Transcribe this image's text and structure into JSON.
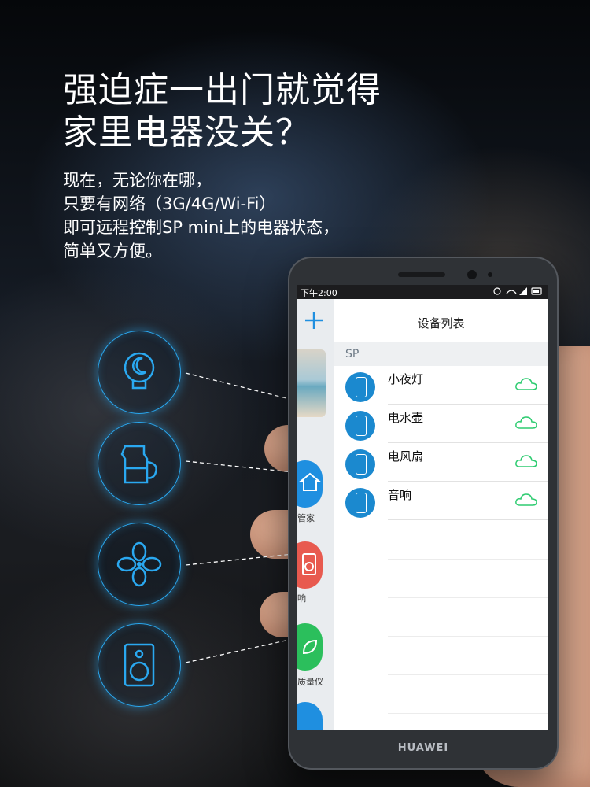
{
  "headline": {
    "line1": "强迫症一出门就觉得",
    "line2": "家里电器没关？"
  },
  "subtext": {
    "line1": "现在，无论你在哪，",
    "line2": "只要有网络（3G/4G/Wi-Fi）",
    "line3": "即可远程控制SP mini上的电器状态，",
    "line4": "简单又方便。"
  },
  "features": [
    {
      "icon": "night-light-icon"
    },
    {
      "icon": "kettle-icon"
    },
    {
      "icon": "fan-icon"
    },
    {
      "icon": "speaker-icon"
    }
  ],
  "phone": {
    "brand": "HUAWEI",
    "statusbar": {
      "time": "下午2:00"
    },
    "side_apps": [
      {
        "label": "管家"
      },
      {
        "label": "响"
      },
      {
        "label": "质量仪"
      }
    ],
    "nav": {
      "title": "设备列表",
      "add_icon": "plus-icon"
    },
    "section_label": "SP",
    "devices": [
      {
        "name": "小夜灯",
        "status_icon": "cloud-icon"
      },
      {
        "name": "电水壶",
        "status_icon": "cloud-icon"
      },
      {
        "name": "电风扇",
        "status_icon": "cloud-icon"
      },
      {
        "name": "音响",
        "status_icon": "cloud-icon"
      }
    ]
  },
  "colors": {
    "accent": "#2aa8f0",
    "device_icon": "#1b89cf",
    "cloud": "#2ecc71",
    "add": "#1f8fe0"
  }
}
